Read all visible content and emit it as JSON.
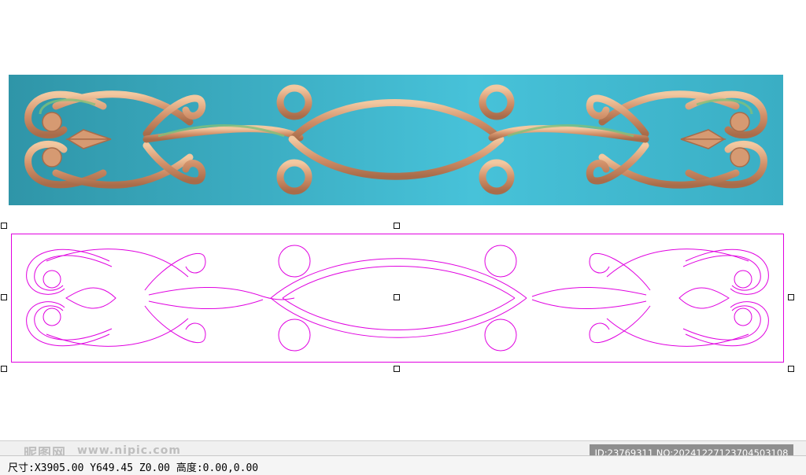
{
  "status": {
    "text": "尺寸:X3905.00 Y649.45 Z0.00 高度:0.00,0.00"
  },
  "watermark": {
    "logo": "昵图网",
    "url": "www.nipic.com",
    "id_badge": "ID:23769311 NO:20241227123704503108"
  },
  "colors": {
    "relief_background": "#3fbcd0",
    "relief_ornament": "#d69a72",
    "relief_ornament_green": "#7fbf7a",
    "vector_stroke": "#e000e0",
    "selection_handle": "#111111"
  },
  "icons": [
    "selection-handle"
  ]
}
